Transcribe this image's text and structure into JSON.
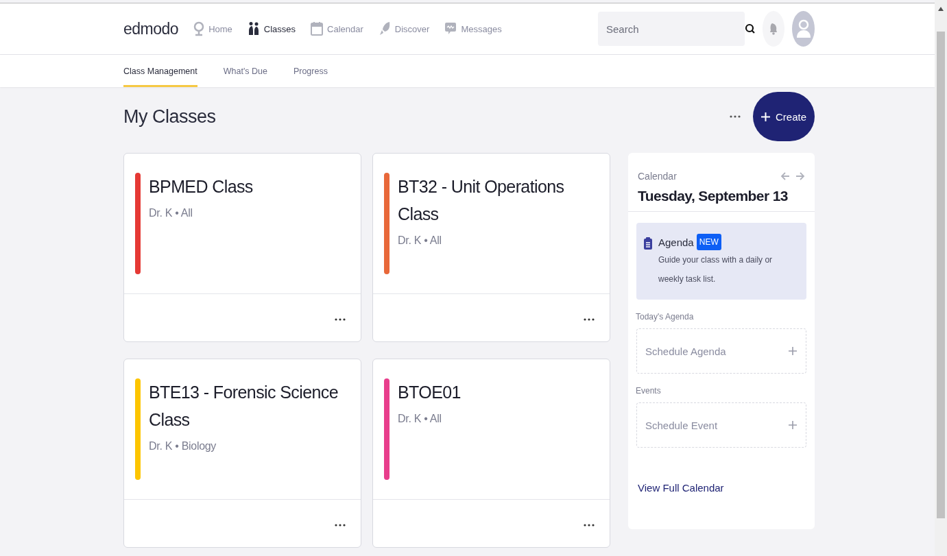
{
  "header": {
    "logo": "edmodo",
    "nav": [
      {
        "label": "Home",
        "selected": false
      },
      {
        "label": "Classes",
        "selected": true
      },
      {
        "label": "Calendar",
        "selected": false
      },
      {
        "label": "Discover",
        "selected": false
      },
      {
        "label": "Messages",
        "selected": false
      }
    ],
    "search": {
      "placeholder": "Search"
    }
  },
  "subnav": [
    {
      "label": "Class Management",
      "selected": true
    },
    {
      "label": "What's Due",
      "selected": false
    },
    {
      "label": "Progress",
      "selected": false
    }
  ],
  "page_title": "My Classes",
  "create_button": "Create",
  "classes": [
    {
      "name": "BPMED Class",
      "meta": "Dr. K • All",
      "color": "#e53935"
    },
    {
      "name": "BT32 - Unit Operations Class",
      "meta": "Dr. K • All",
      "color": "#e8683a"
    },
    {
      "name": "BTE13 - Forensic Science Class",
      "meta": "Dr. K • Biology",
      "color": "#fdc500"
    },
    {
      "name": "BTOE01",
      "meta": "Dr. K • All",
      "color": "#e83e8c"
    }
  ],
  "calendar": {
    "label": "Calendar",
    "date": "Tuesday, September 13",
    "promo": {
      "title": "Agenda",
      "badge": "NEW",
      "text": "Guide your class with a daily or weekly task list."
    },
    "sections": [
      {
        "heading": "Today's Agenda",
        "action": "Schedule Agenda"
      },
      {
        "heading": "Events",
        "action": "Schedule Event"
      }
    ],
    "link": "View Full Calendar"
  }
}
